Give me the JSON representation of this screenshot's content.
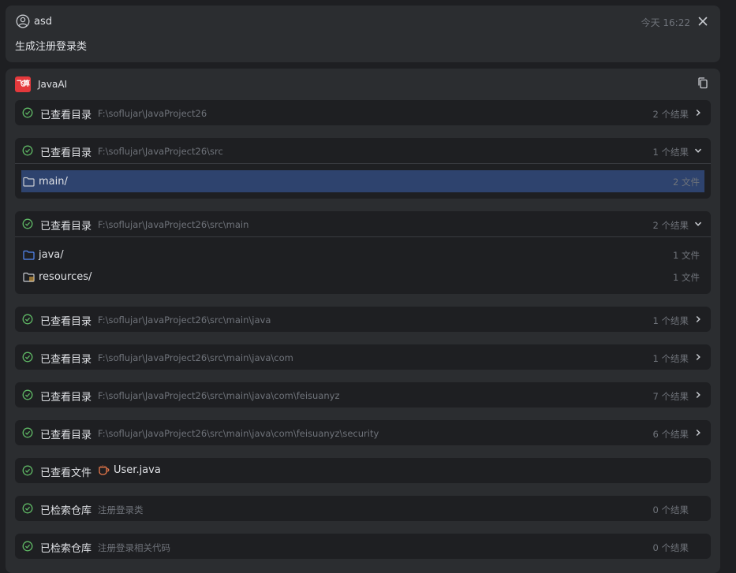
{
  "user_message": {
    "user": "asd",
    "time": "今天 16:22",
    "text": "生成注册登录类"
  },
  "assistant": {
    "logo_text": "飞算",
    "name": "JavaAI",
    "steps": [
      {
        "title": "已查看目录",
        "path": "F:\\soflujar\\JavaProject26",
        "count": "2 个结果",
        "expanded": false
      },
      {
        "title": "已查看目录",
        "path": "F:\\soflujar\\JavaProject26\\src",
        "count": "1 个结果",
        "expanded": true,
        "items": [
          {
            "name": "main/",
            "count": "2 文件",
            "selected": true
          }
        ]
      },
      {
        "title": "已查看目录",
        "path": "F:\\soflujar\\JavaProject26\\src\\main",
        "count": "2 个结果",
        "expanded": true,
        "items": [
          {
            "name": "java/",
            "count": "1 文件"
          },
          {
            "name": "resources/",
            "count": "1 文件"
          }
        ]
      },
      {
        "title": "已查看目录",
        "path": "F:\\soflujar\\JavaProject26\\src\\main\\java",
        "count": "1 个结果",
        "expanded": false
      },
      {
        "title": "已查看目录",
        "path": "F:\\soflujar\\JavaProject26\\src\\main\\java\\com",
        "count": "1 个结果",
        "expanded": false
      },
      {
        "title": "已查看目录",
        "path": "F:\\soflujar\\JavaProject26\\src\\main\\java\\com\\feisuanyz",
        "count": "7 个结果",
        "expanded": false
      },
      {
        "title": "已查看目录",
        "path": "F:\\soflujar\\JavaProject26\\src\\main\\java\\com\\feisuanyz\\security",
        "count": "6 个结果",
        "expanded": false
      },
      {
        "title": "已查看文件",
        "file": "User.java"
      },
      {
        "title": "已检索仓库",
        "path": "注册登录类",
        "count": "0 个结果"
      },
      {
        "title": "已检索仓库",
        "path": "注册登录相关代码",
        "count": "0 个结果"
      }
    ]
  },
  "colors": {
    "background": "#1e1f22",
    "card": "#2b2d30",
    "check_green": "#5fb865",
    "selection": "#2e436e",
    "folder_blue": "#548af7",
    "java_icon": "#e8784a"
  },
  "icons": {
    "user": "user-circle-icon",
    "close": "close-icon",
    "copy": "copy-icon",
    "check": "check-circle-icon",
    "chevron_right": "chevron-right-icon",
    "chevron_down": "chevron-down-icon",
    "folder": "folder-icon",
    "resources_folder": "resources-folder-icon",
    "java_file": "java-file-icon"
  }
}
